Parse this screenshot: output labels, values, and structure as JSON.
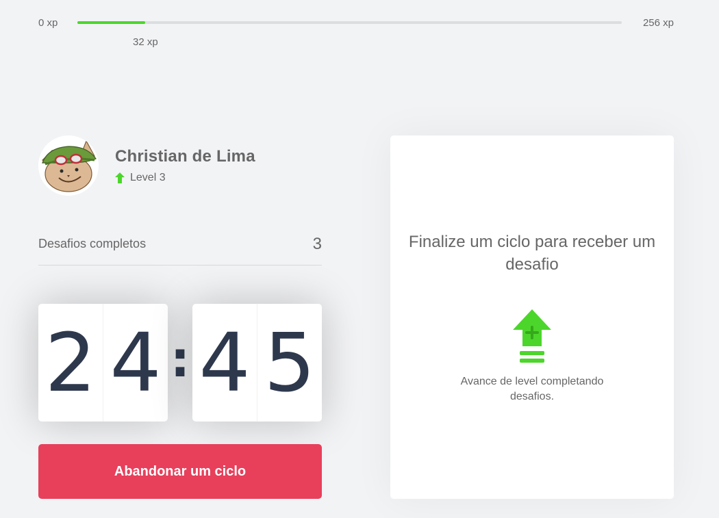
{
  "experience": {
    "min_label": "0 xp",
    "max_label": "256 xp",
    "current_label": "32 xp",
    "current_xp": 32,
    "max_xp": 256,
    "progress_fraction": 0.125,
    "bar_color": "#4cd62b"
  },
  "profile": {
    "name": "Christian de Lima",
    "level_label": "Level 3",
    "avatar_icon": "teemo-avatar",
    "level_icon": "level-up-arrow-icon"
  },
  "completed_challenges": {
    "label": "Desafios completos",
    "count": "3"
  },
  "countdown": {
    "minute_left": "2",
    "minute_right": "4",
    "separator": ":",
    "second_left": "4",
    "second_right": "5"
  },
  "actions": {
    "abandon_label": "Abandonar um ciclo",
    "abandon_color": "#e83f5b"
  },
  "challenge_box": {
    "title": "Finalize um ciclo para receber um desafio",
    "hint": "Avance de level completando desafios.",
    "icon": "level-up-icon",
    "icon_color": "#4cd62b"
  }
}
